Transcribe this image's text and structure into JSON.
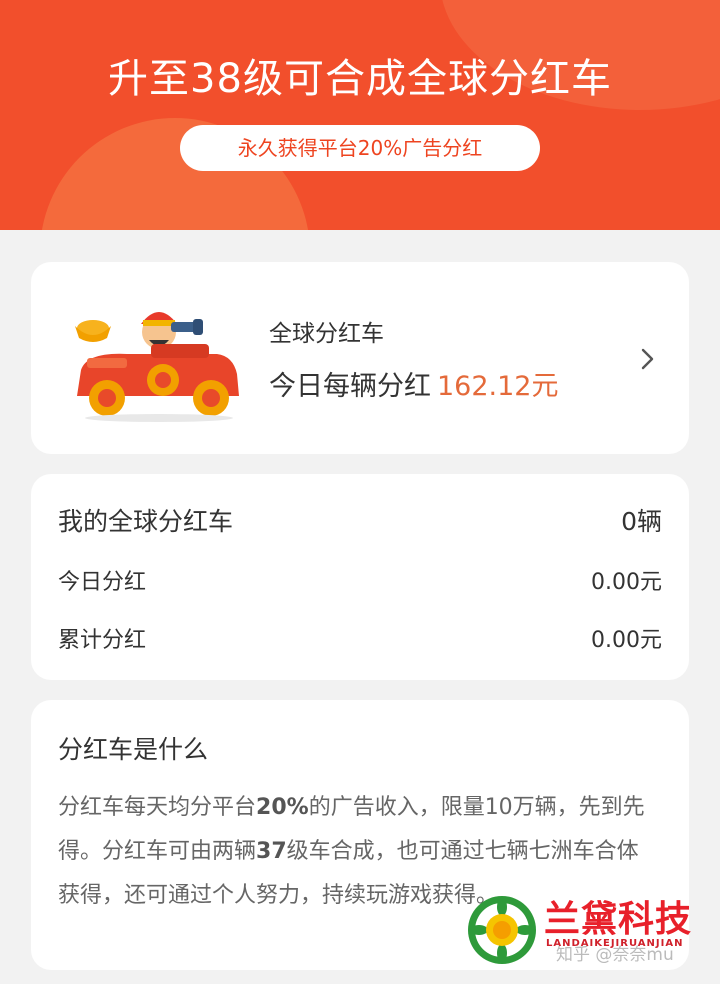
{
  "banner": {
    "title": "升至38级可合成全球分红车",
    "pill": "永久获得平台20%广告分红"
  },
  "car_card": {
    "title": "全球分红车",
    "today_label": "今日每辆分红",
    "today_amount": "162.12元"
  },
  "my_cars": {
    "title": "我的全球分红车",
    "count": "0辆",
    "rows": [
      {
        "label": "今日分红",
        "value": "0.00元"
      },
      {
        "label": "累计分红",
        "value": "0.00元"
      }
    ]
  },
  "info": {
    "title": "分红车是什么",
    "text_a": "分红车每天均分平台",
    "text_b": "20%",
    "text_c": "的广告收入，限量10万辆，先到先得。分红车可由两辆",
    "text_d": "37",
    "text_e": "级车合成，也可通过七辆七洲车合体获得，还可通过个人努力，持续玩游戏获得。"
  },
  "watermark": "知乎 @奈奈mu",
  "logo": {
    "name": "兰黛科技",
    "subtitle": "LANDAIKEJIRUANJIAN"
  },
  "colors": {
    "banner": "#f24f2c",
    "accent_amount": "#e46a3a",
    "logo_red": "#e8202a"
  },
  "icons": [
    "car-illustration",
    "chevron-right-icon",
    "logo-icon"
  ]
}
